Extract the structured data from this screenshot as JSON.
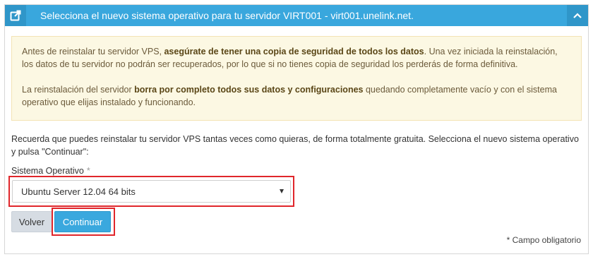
{
  "header": {
    "title": "Selecciona el nuevo sistema operativo para tu servidor VIRT001 - virt001.unelink.net.",
    "icon": "external-link-icon",
    "collapse_icon": "chevron-up-icon"
  },
  "warning": {
    "p1_a": "Antes de reinstalar tu servidor VPS, ",
    "p1_b": "asegúrate de tener una copia de seguridad de todos los datos",
    "p1_c": ". Una vez iniciada la reinstalación, los datos de tu servidor no podrán ser recuperados, por lo que si no tienes copia de seguridad los perderás de forma definitiva.",
    "p2_a": "La reinstalación del servidor ",
    "p2_b": "borra por completo todos sus datos y configuraciones",
    "p2_c": " quedando completamente vacío y con el sistema operativo que elijas instalado y funcionando."
  },
  "intro": "Recuerda que puedes reinstalar tu servidor VPS tantas veces como quieras, de forma totalmente gratuita. Selecciona el nuevo sistema operativo y pulsa \"Continuar\":",
  "field": {
    "label": "Sistema Operativo",
    "required_mark": "*",
    "selected": "Ubuntu Server 12.04 64 bits"
  },
  "buttons": {
    "back": "Volver",
    "continue": "Continuar"
  },
  "required_note": "* Campo obligatorio",
  "colors": {
    "header": "#39a7dd",
    "highlight": "#e0262b",
    "warning_bg": "#fcf8e3"
  }
}
